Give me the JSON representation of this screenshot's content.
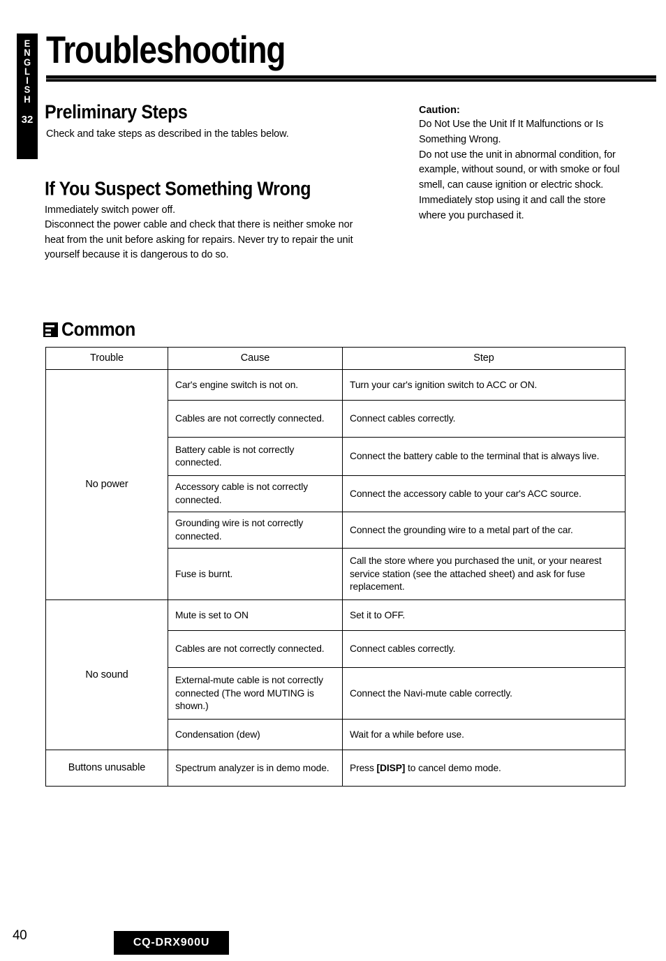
{
  "language_tab": {
    "letters": [
      "E",
      "N",
      "G",
      "L",
      "I",
      "S",
      "H"
    ],
    "page_number": "32"
  },
  "page_title": "Troubleshooting",
  "sections": {
    "preliminary": {
      "heading": "Preliminary Steps",
      "text": "Check and take steps as described in the tables below."
    },
    "suspect": {
      "heading": "If You Suspect Something Wrong",
      "line1": "Immediately switch power off.",
      "line2": "Disconnect the power cable and check that there is neither smoke nor heat from the unit before asking for repairs. Never try to repair the unit yourself because it is dangerous to do so."
    },
    "caution": {
      "title": "Caution:",
      "line1": "Do Not Use the Unit If It Malfunctions or Is Something Wrong.",
      "line2": "Do not use the unit in abnormal condition, for example, without sound, or with smoke or foul smell, can cause ignition or electric shock. Immediately stop using it and call the store where you purchased it."
    },
    "common": {
      "icon": "book-square-icon",
      "title": "Common"
    }
  },
  "table": {
    "headers": {
      "trouble": "Trouble",
      "cause": "Cause",
      "step": "Step"
    },
    "groups": [
      {
        "trouble": "No power",
        "rows": [
          {
            "cause": "Car's engine switch is not on.",
            "step": "Turn your car's ignition switch to ACC or ON."
          },
          {
            "cause": "Cables are not correctly connected.",
            "step": "Connect cables correctly."
          },
          {
            "cause": "Battery cable is not correctly connected.",
            "step": "Connect the battery cable to the terminal that is always live."
          },
          {
            "cause": "Accessory cable is not correctly connected.",
            "step": "Connect the accessory cable to your car's ACC source."
          },
          {
            "cause": "Grounding wire is not correctly connected.",
            "step": "Connect the grounding wire to a metal part of the car."
          },
          {
            "cause": "Fuse is burnt.",
            "step": "Call the store where you purchased the unit, or your nearest service station (see the attached sheet) and ask for fuse replacement."
          }
        ]
      },
      {
        "trouble": "No sound",
        "rows": [
          {
            "cause": "Mute is set to ON",
            "step": "Set it to OFF."
          },
          {
            "cause": "Cables are not correctly connected.",
            "step": "Connect cables correctly."
          },
          {
            "cause": "External-mute cable is not correctly connected (The word MUTING is shown.)",
            "step": "Connect the Navi-mute cable correctly."
          },
          {
            "cause": "Condensation (dew)",
            "step": "Wait for a while before use."
          }
        ]
      },
      {
        "trouble": "Buttons unusable",
        "rows": [
          {
            "cause": "Spectrum analyzer is in demo mode.",
            "step_prefix": "Press ",
            "step_key": "[DISP]",
            "step_suffix": " to cancel demo mode."
          }
        ]
      }
    ]
  },
  "footer": {
    "page_number": "40",
    "model": "CQ-DRX900U"
  }
}
